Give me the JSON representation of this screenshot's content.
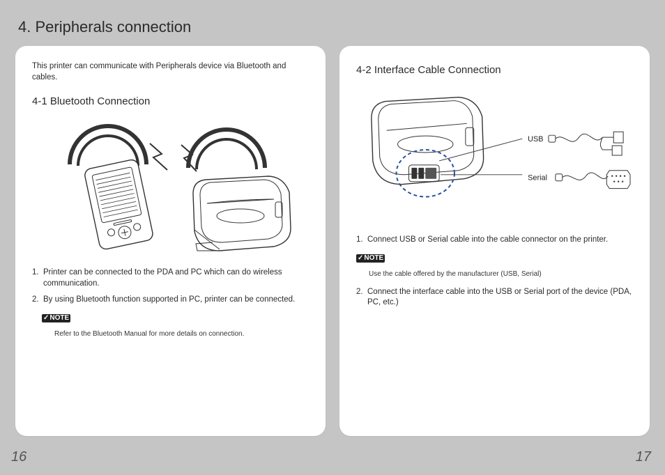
{
  "section_title": "4. Peripherals connection",
  "left": {
    "intro": "This printer can communicate with Peripherals device via Bluetooth and cables.",
    "sub_title": "4-1 Bluetooth Connection",
    "items": [
      {
        "num": "1.",
        "text": "Printer can be connected to the PDA and PC which can do wireless communication."
      },
      {
        "num": "2.",
        "text": "By using Bluetooth function supported in PC, printer can be connected."
      }
    ],
    "note_label": "NOTE",
    "note_body": "Refer to the Bluetooth Manual for more details on connection.",
    "page_num": "16"
  },
  "right": {
    "sub_title": "4-2 Interface Cable Connection",
    "labels": {
      "usb": "USB",
      "serial": "Serial"
    },
    "item1": {
      "num": "1.",
      "text": "Connect USB or Serial cable into the cable connector on the printer."
    },
    "note_label": "NOTE",
    "note_body": "Use the cable offered by the manufacturer (USB, Serial)",
    "item2": {
      "num": "2.",
      "text": "Connect the interface cable into the USB or Serial port of the device (PDA, PC, etc.)"
    },
    "page_num": "17"
  }
}
